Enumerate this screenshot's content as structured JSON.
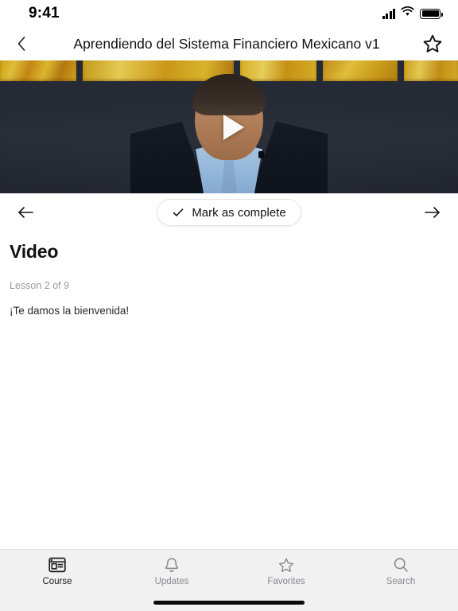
{
  "status_bar": {
    "time": "9:41",
    "signal_icon": "cellular-signal-icon",
    "wifi_icon": "wifi-icon",
    "battery_icon": "battery-icon"
  },
  "header": {
    "back_icon": "chevron-left-icon",
    "title": "Aprendiendo del Sistema Financiero Mexicano v1",
    "favorite_icon": "star-outline-icon"
  },
  "video": {
    "play_icon": "play-triangle-icon",
    "alt": "Video thumbnail: presenter in dark suit and light blue shirt"
  },
  "lesson_nav": {
    "prev_icon": "arrow-left-icon",
    "next_icon": "arrow-right-icon",
    "mark_complete_label": "Mark as complete",
    "mark_complete_icon": "check-icon"
  },
  "lesson": {
    "title": "Video",
    "meta": "Lesson 2 of 9",
    "body": "¡Te damos la bienvenida!"
  },
  "tab_bar": {
    "items": [
      {
        "label": "Course",
        "icon": "course-layout-icon",
        "active": true
      },
      {
        "label": "Updates",
        "icon": "bell-icon",
        "active": false
      },
      {
        "label": "Favorites",
        "icon": "star-outline-icon",
        "active": false
      },
      {
        "label": "Search",
        "icon": "search-icon",
        "active": false
      }
    ]
  },
  "colors": {
    "background": "#ffffff",
    "tab_bar_background": "#f1f1f1",
    "text_primary": "#111111",
    "text_muted": "#9a9a9a",
    "tab_inactive": "#8a8a8e",
    "tab_active": "#1c1c1e"
  }
}
